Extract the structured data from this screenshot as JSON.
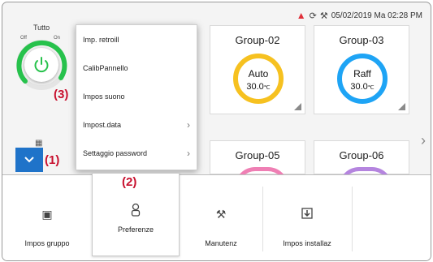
{
  "status": {
    "date_time": "05/02/2019 Ma 02:28 PM",
    "icons": [
      "warning-icon",
      "refresh-icon",
      "maintenance-icon"
    ]
  },
  "all_switch": {
    "title": "Tutto",
    "off_label": "Off",
    "on_label": "On",
    "state_color": "#27c24c"
  },
  "menu": {
    "items": [
      {
        "label": "Imp. retroill",
        "has_submenu": false
      },
      {
        "label": "CalibPannello",
        "has_submenu": false
      },
      {
        "label": "Impos suono",
        "has_submenu": false
      },
      {
        "label": "Impost.data",
        "has_submenu": true
      },
      {
        "label": "Settaggio password",
        "has_submenu": true
      }
    ]
  },
  "groups": [
    {
      "name": "Group-02",
      "mode": "Auto",
      "temp": "30.0",
      "unit": "℃",
      "ring_color": "#f6c120"
    },
    {
      "name": "Group-03",
      "mode": "Raff",
      "temp": "30.0",
      "unit": "℃",
      "ring_color": "#1ea4f5"
    },
    {
      "name": "Group-05",
      "ring_color": "#ef7fb4"
    },
    {
      "name": "Group-06",
      "ring_color": "#b585df"
    }
  ],
  "toolbar": {
    "items": [
      {
        "label": "Impos gruppo",
        "icon": "group-icon"
      },
      {
        "label": "Preferenze",
        "icon": "preferences-icon"
      },
      {
        "label": "Manutenz",
        "icon": "maintenance-icon"
      },
      {
        "label": "Impos installaz",
        "icon": "install-icon"
      }
    ],
    "selected": "Preferenze"
  },
  "callouts": {
    "c1": "(1)",
    "c2": "(2)",
    "c3": "(3)"
  },
  "colors": {
    "accent": "#1f73c9",
    "callout": "#c8102e",
    "warning": "#e0303a"
  }
}
